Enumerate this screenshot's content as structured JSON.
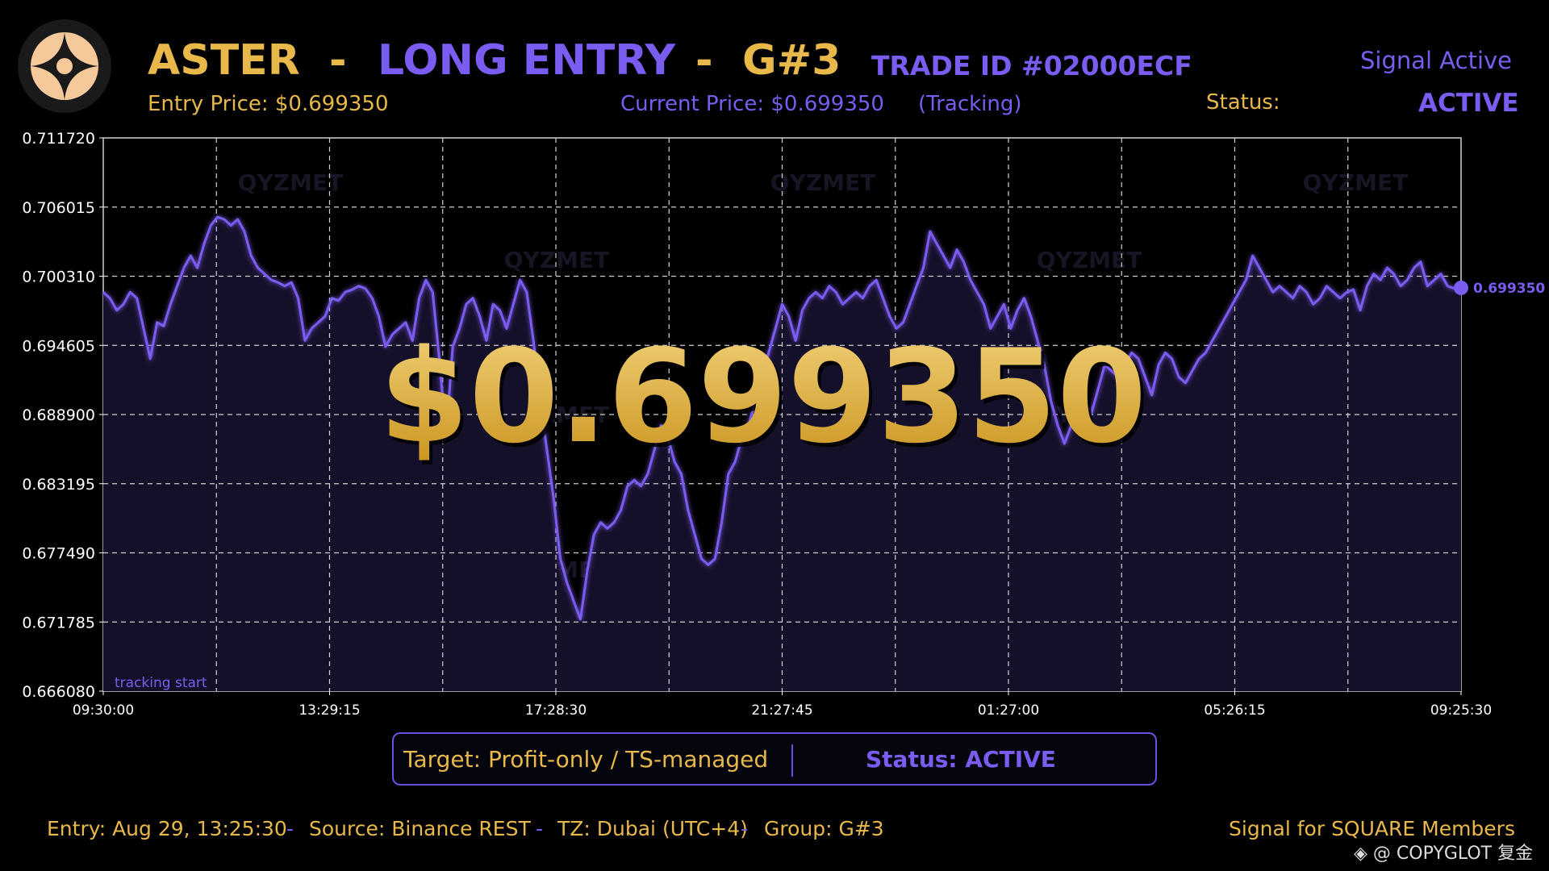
{
  "header": {
    "symbol": "ASTER",
    "sep1": "-",
    "direction": "LONG ENTRY",
    "sep2": "-",
    "group": "G#3",
    "trade_id": "TRADE ID #02000ECF",
    "signal_state": "Signal Active",
    "entry_price": "Entry Price: $0.699350",
    "current_price": "Current Price: $0.699350",
    "tracking": "(Tracking)",
    "status_label": "Status:",
    "status_value": "ACTIVE"
  },
  "overlay_price": "$0.699350",
  "target_box": {
    "target": "Target: Profit-only / TS-managed",
    "status": "Status: ACTIVE"
  },
  "footer": {
    "entry": "Entry: Aug 29, 13:25:30",
    "sep1": "-",
    "source": "Source: Binance REST",
    "sep2": "-",
    "tz": "TZ: Dubai (UTC+4)",
    "sep3": "-",
    "group": "Group: G#3",
    "members": "Signal for SQUARE Members",
    "copyright": "@ COPYGLOT 复金"
  },
  "colors": {
    "gold": "#e8b84a",
    "purple": "#7b5cf0",
    "plot_bg": "#15102a"
  },
  "icons": {
    "logo": "aster-logo-icon",
    "copyright": "diamond-icon"
  },
  "chart_data": {
    "type": "line",
    "xlabel": "",
    "ylabel": "",
    "x_ticks": [
      "09:30:00",
      "13:29:15",
      "17:28:30",
      "21:27:45",
      "01:27:00",
      "05:26:15",
      "09:25:30"
    ],
    "y_ticks": [
      "0.711720",
      "0.706015",
      "0.700310",
      "0.694605",
      "0.688900",
      "0.683195",
      "0.677490",
      "0.671785",
      "0.666080"
    ],
    "ylim": [
      0.66608,
      0.71172
    ],
    "grid": true,
    "last_value_label": "0.699350",
    "annotation": "tracking start",
    "watermark": "QYZMET",
    "series": [
      {
        "values": [
          0.699,
          0.6985,
          0.6975,
          0.698,
          0.699,
          0.6985,
          0.696,
          0.6935,
          0.6965,
          0.6962,
          0.698,
          0.6995,
          0.701,
          0.702,
          0.701,
          0.703,
          0.7045,
          0.7052,
          0.705,
          0.7045,
          0.705,
          0.704,
          0.702,
          0.701,
          0.7005,
          0.7,
          0.6998,
          0.6995,
          0.6998,
          0.6985,
          0.695,
          0.696,
          0.6965,
          0.697,
          0.6985,
          0.6983,
          0.699,
          0.6992,
          0.6995,
          0.6993,
          0.6985,
          0.697,
          0.6945,
          0.6955,
          0.696,
          0.6965,
          0.695,
          0.6985,
          0.7,
          0.699,
          0.6935,
          0.687,
          0.6945,
          0.696,
          0.698,
          0.6985,
          0.697,
          0.695,
          0.698,
          0.6975,
          0.696,
          0.698,
          0.7,
          0.699,
          0.695,
          0.69,
          0.686,
          0.682,
          0.677,
          0.675,
          0.6735,
          0.672,
          0.676,
          0.679,
          0.68,
          0.6795,
          0.68,
          0.681,
          0.683,
          0.6835,
          0.683,
          0.684,
          0.686,
          0.688,
          0.687,
          0.685,
          0.684,
          0.681,
          0.679,
          0.677,
          0.6765,
          0.677,
          0.68,
          0.684,
          0.685,
          0.687,
          0.688,
          0.69,
          0.692,
          0.694,
          0.696,
          0.698,
          0.697,
          0.695,
          0.6975,
          0.6985,
          0.699,
          0.6985,
          0.6995,
          0.699,
          0.698,
          0.6985,
          0.699,
          0.6985,
          0.6995,
          0.7,
          0.6985,
          0.697,
          0.696,
          0.6965,
          0.698,
          0.6995,
          0.701,
          0.704,
          0.703,
          0.702,
          0.701,
          0.7025,
          0.7015,
          0.7,
          0.699,
          0.698,
          0.696,
          0.697,
          0.698,
          0.696,
          0.6975,
          0.6985,
          0.697,
          0.695,
          0.693,
          0.69,
          0.688,
          0.6865,
          0.688,
          0.689,
          0.69,
          0.689,
          0.691,
          0.693,
          0.6925,
          0.692,
          0.693,
          0.694,
          0.6935,
          0.692,
          0.6905,
          0.693,
          0.694,
          0.6935,
          0.692,
          0.6915,
          0.6925,
          0.6935,
          0.694,
          0.695,
          0.696,
          0.697,
          0.698,
          0.699,
          0.7,
          0.702,
          0.701,
          0.7,
          0.699,
          0.6995,
          0.699,
          0.6985,
          0.6995,
          0.699,
          0.698,
          0.6985,
          0.6995,
          0.699,
          0.6985,
          0.699,
          0.6992,
          0.6975,
          0.6995,
          0.7005,
          0.7,
          0.701,
          0.7005,
          0.6995,
          0.7,
          0.701,
          0.7015,
          0.6995,
          0.7,
          0.7005,
          0.6995,
          0.6993,
          0.69935
        ]
      }
    ]
  }
}
